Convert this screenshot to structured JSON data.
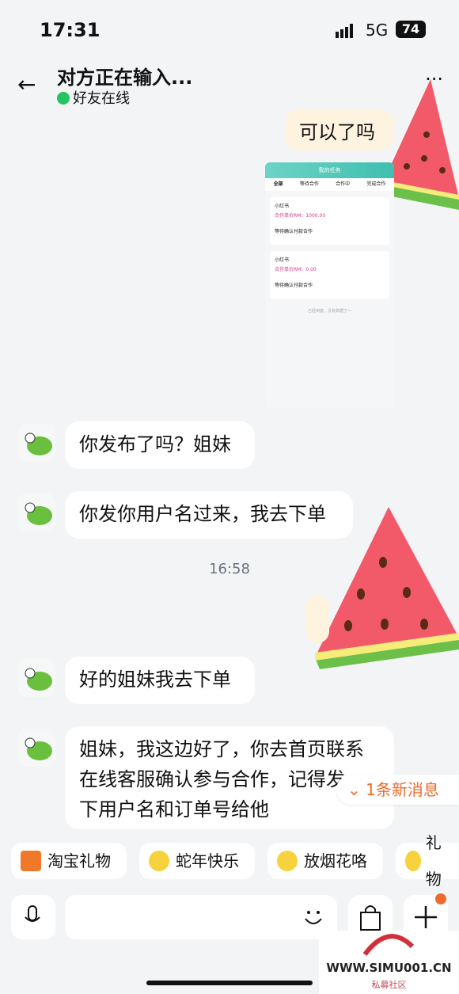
{
  "status": {
    "time": "17:31",
    "network": "5G",
    "battery": "74"
  },
  "header": {
    "title": "对方正在输入...",
    "online": "好友在线"
  },
  "messages": {
    "out1": "可以了吗",
    "m1": "你发布了吗？姐妹",
    "m2": "你发你用户名过来，我去下单",
    "timestamp": "16:58",
    "m3": "好的姐妹我去下单",
    "m4": "姐妹，我这边好了，你去首页联系在线客服确认参与合作，记得发一下用户名和订单号给他"
  },
  "screenshot": {
    "title": "我的任务",
    "tabs": [
      "全部",
      "等待合作",
      "合作中",
      "完成合作"
    ],
    "cards": [
      {
        "platform": "小红书",
        "price": "合作单价RM：1000.00",
        "status": "等待确认付款合作"
      },
      {
        "platform": "小红书",
        "price": "合作单价RM：0.00",
        "status": "等待确认付款合作"
      }
    ],
    "footer": "已经到底，没有数据了～"
  },
  "new_message": "1条新消息",
  "chips": [
    "淘宝礼物",
    "蛇年快乐",
    "放烟花咯",
    "礼物"
  ],
  "watermark": {
    "site": "WWW.SIMU001.CN",
    "sub": "私募社区"
  },
  "colors": {
    "accent": "#ef6b2b",
    "online": "#22c55e",
    "out_bubble": "#fdf3df"
  }
}
